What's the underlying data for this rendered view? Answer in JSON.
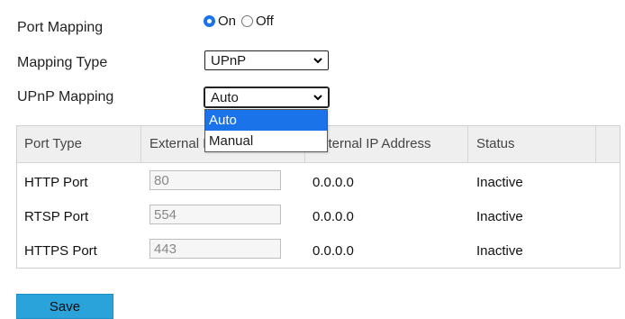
{
  "form": {
    "port_mapping_label": "Port Mapping",
    "port_mapping_on": "On",
    "port_mapping_off": "Off",
    "port_mapping_selected": "On",
    "mapping_type_label": "Mapping Type",
    "mapping_type_value": "UPnP",
    "upnp_mapping_label": "UPnP Mapping",
    "upnp_mapping_value": "Auto"
  },
  "dropdown": {
    "options": [
      "Auto",
      "Manual"
    ],
    "highlighted": "Auto"
  },
  "table": {
    "headers": [
      "Port Type",
      "External Port",
      "External IP Address",
      "Status"
    ],
    "rows": [
      {
        "port_type": "HTTP Port",
        "external_port": "80",
        "external_ip": "0.0.0.0",
        "status": "Inactive"
      },
      {
        "port_type": "RTSP Port",
        "external_port": "554",
        "external_ip": "0.0.0.0",
        "status": "Inactive"
      },
      {
        "port_type": "HTTPS Port",
        "external_port": "443",
        "external_ip": "0.0.0.0",
        "status": "Inactive"
      }
    ]
  },
  "actions": {
    "save_label": "Save"
  },
  "colors": {
    "accent": "#1a73e8",
    "save_button": "#2aa3db",
    "header_bg": "#efefef"
  }
}
